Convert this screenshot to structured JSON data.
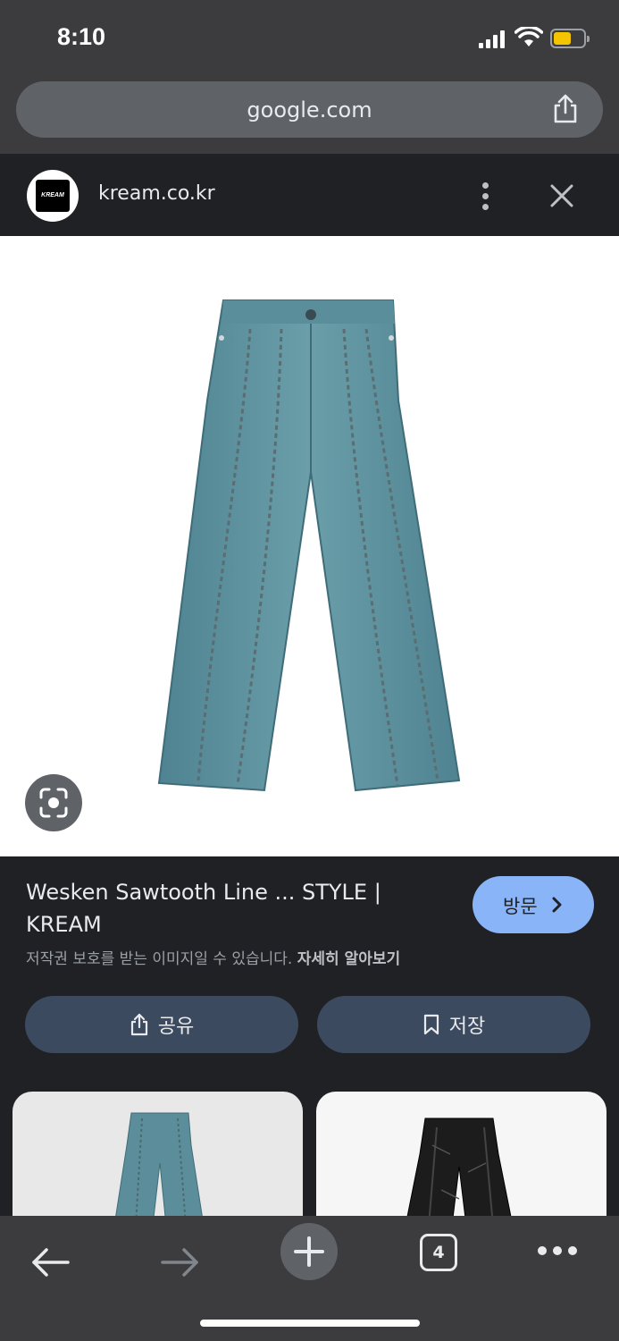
{
  "status_bar": {
    "time": "8:10"
  },
  "browser": {
    "url": "google.com"
  },
  "source": {
    "favicon_text": "KREAM",
    "domain": "kream.co.kr"
  },
  "result": {
    "title": "Wesken Sawtooth Line ... STYLE | KREAM",
    "copyright_prefix": "저작권 보호를 받는 이미지일 수 있습니다.",
    "copyright_link": "자세히 알아보기",
    "visit_label": "방문",
    "share_label": "공유",
    "save_label": "저장"
  },
  "toolbar": {
    "tab_count": "4"
  },
  "colors": {
    "accent": "#8ab4f8",
    "denim": "#5b8e9a",
    "battery": "#f4c400"
  }
}
